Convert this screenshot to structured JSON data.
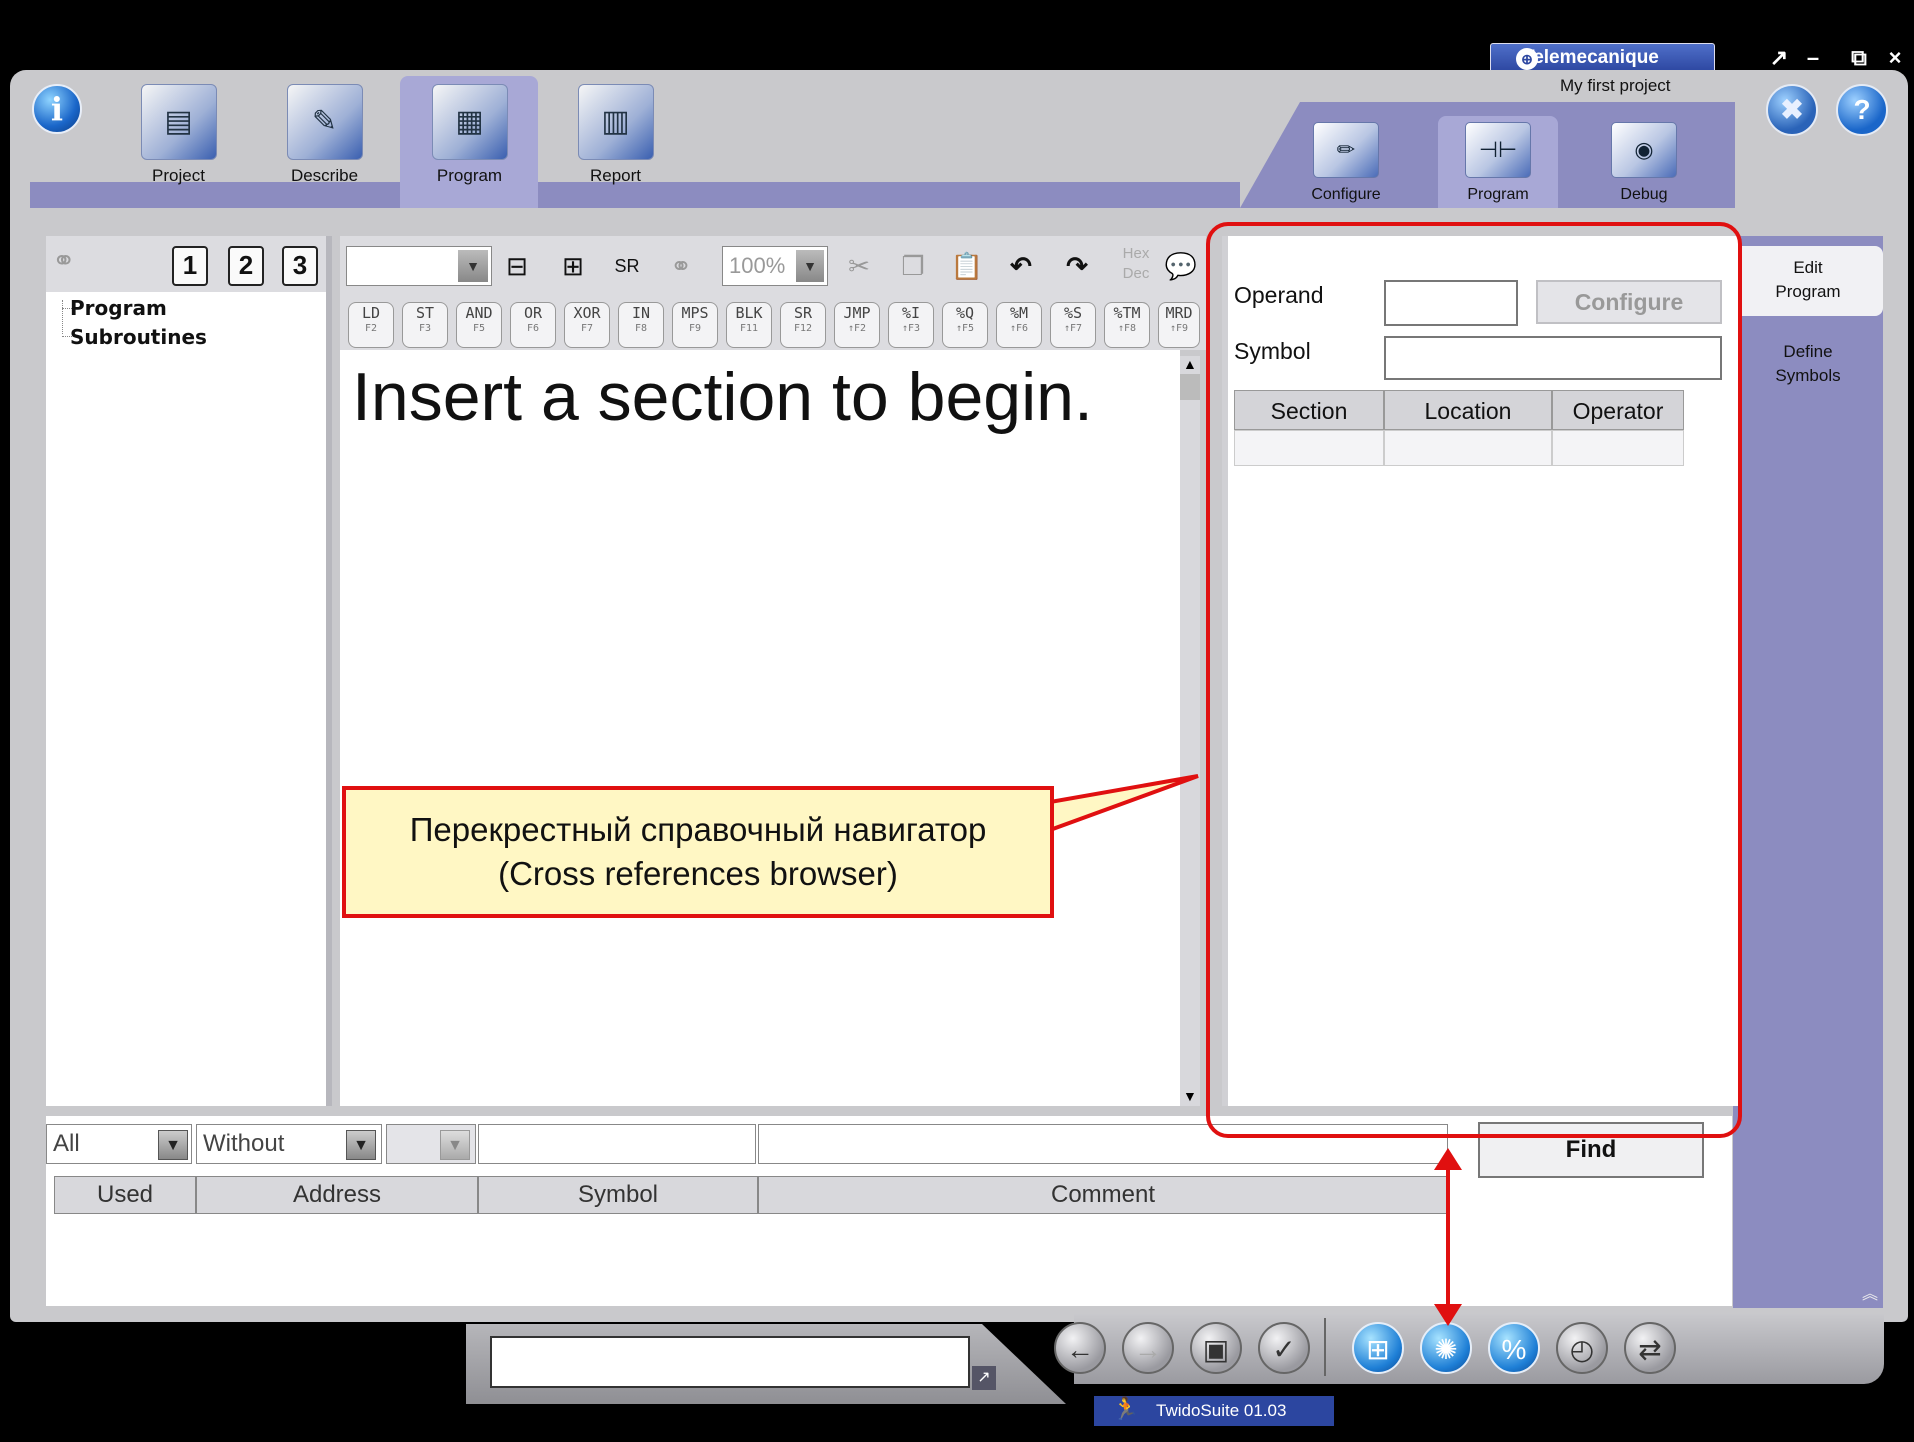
{
  "branding": {
    "brand": "Telemecanique",
    "project_name": "My first project",
    "version": "TwidoSuite 01.03"
  },
  "window_controls": {
    "restore_arrow": "↗",
    "minimize": "–",
    "maximize": "⧉",
    "close": "×"
  },
  "top_nav": {
    "tabs": [
      {
        "label": "Project",
        "icon": "folder-documents-icon"
      },
      {
        "label": "Describe",
        "icon": "folder-describe-icon"
      },
      {
        "label": "Program",
        "icon": "folder-program-icon",
        "active": true
      },
      {
        "label": "Report",
        "icon": "folder-report-icon"
      }
    ]
  },
  "program_tabs": [
    {
      "label": "Configure"
    },
    {
      "label": "Program",
      "active": true
    },
    {
      "label": "Debug"
    }
  ],
  "right_sidebar": {
    "items": [
      {
        "label": "Edit Program",
        "active": true
      },
      {
        "label": "Define Symbols"
      }
    ]
  },
  "tree": {
    "num_buttons": [
      "1",
      "2",
      "3"
    ],
    "items": [
      "Program",
      "Subroutines"
    ]
  },
  "editor": {
    "zoom": "100%",
    "hex_label": "Hex",
    "dec_label": "Dec",
    "instructions": [
      {
        "label": "LD",
        "key": "F2"
      },
      {
        "label": "ST",
        "key": "F3"
      },
      {
        "label": "AND",
        "key": "F5"
      },
      {
        "label": "OR",
        "key": "F6"
      },
      {
        "label": "XOR",
        "key": "F7"
      },
      {
        "label": "IN",
        "key": "F8"
      },
      {
        "label": "MPS",
        "key": "F9"
      },
      {
        "label": "BLK",
        "key": "F11"
      },
      {
        "label": "SR",
        "key": "F12"
      },
      {
        "label": "JMP",
        "key": "↑F2"
      },
      {
        "label": "%I",
        "key": "↑F3"
      },
      {
        "label": "%Q",
        "key": "↑F5"
      },
      {
        "label": "%M",
        "key": "↑F6"
      },
      {
        "label": "%S",
        "key": "↑F7"
      },
      {
        "label": "%TM",
        "key": "↑F8"
      },
      {
        "label": "MRD",
        "key": "↑F9"
      }
    ],
    "message": "Insert a section to begin."
  },
  "xref": {
    "operand_label": "Operand",
    "symbol_label": "Symbol",
    "configure_label": "Configure",
    "columns": [
      "Section",
      "Location",
      "Operator"
    ]
  },
  "bottom": {
    "filter_all": "All",
    "filter_without": "Without",
    "find_label": "Find",
    "columns": [
      "Used",
      "Address",
      "Symbol",
      "Comment"
    ]
  },
  "annotation": {
    "line1": "Перекрестный справочный навигатор",
    "line2": "(Cross references browser)"
  },
  "colors": {
    "highlight": "#e01010",
    "callout_bg": "#fff7c4",
    "nav_strip": "#8c8cc0"
  }
}
